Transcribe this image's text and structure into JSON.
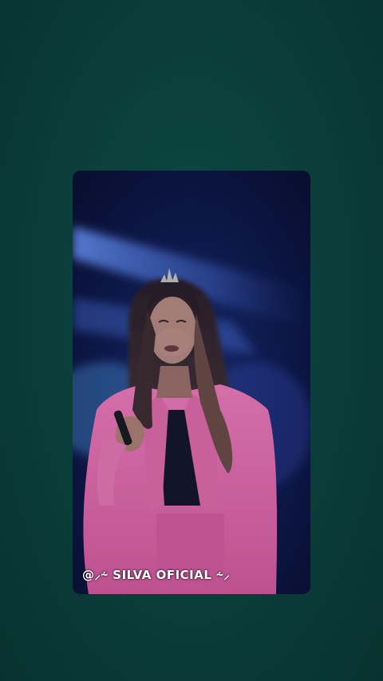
{
  "background_color": "#0b3b37",
  "video": {
    "watermark_text": "@⸝⸞ SILVA OFICIAL ⸞⸝",
    "colors": {
      "stage": "#0a0f2a",
      "light_beam": "#5f8bff",
      "jacket": "#e86aa8",
      "hair": "#3a2a2a",
      "skin": "#b88a7a"
    }
  }
}
